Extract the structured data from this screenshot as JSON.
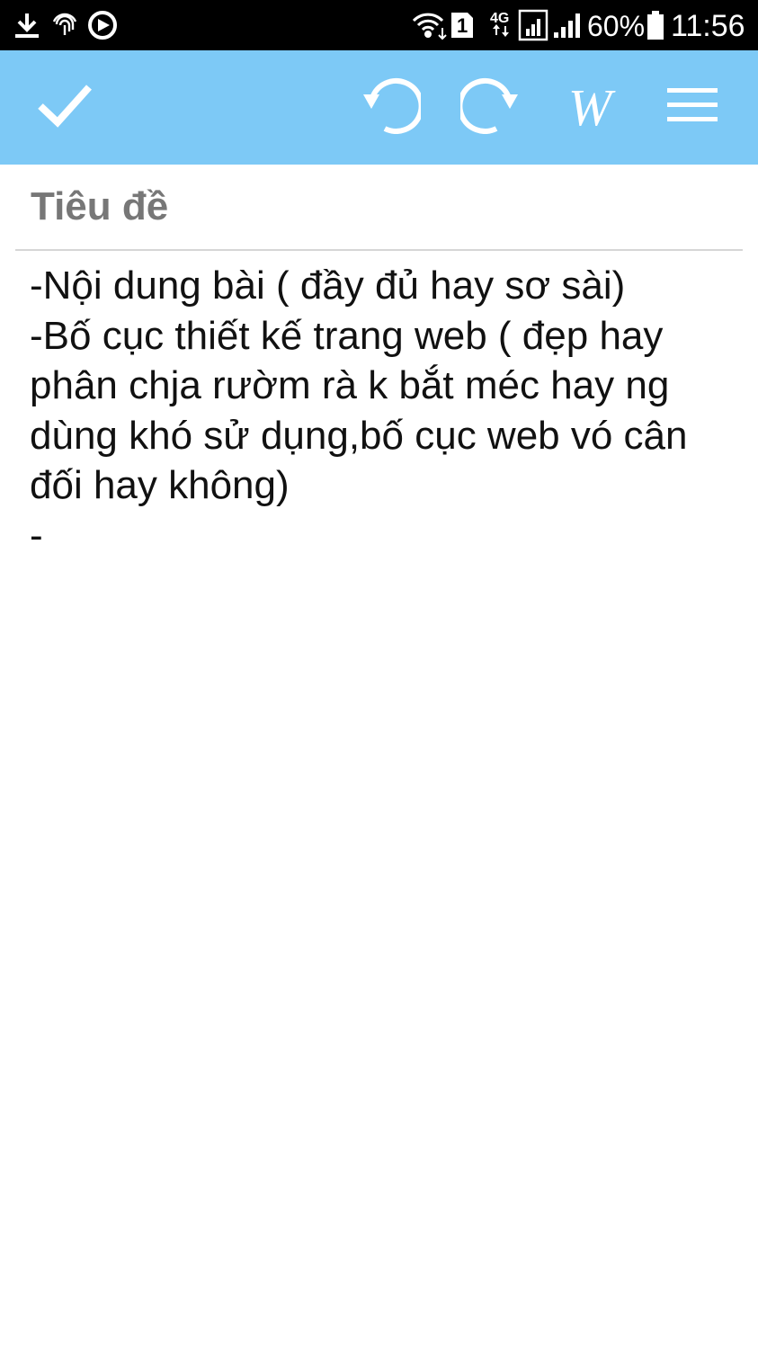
{
  "status_bar": {
    "left_icons": [
      "download-icon",
      "fingerprint-icon",
      "sync-icon"
    ],
    "sim_badge": "1",
    "network_type": "4G",
    "battery": "60%",
    "time": "11:56"
  },
  "toolbar": {
    "save_icon": "check-icon",
    "undo_icon": "undo-icon",
    "redo_icon": "redo-icon",
    "wiki_label": "W",
    "menu_icon": "menu-icon",
    "background_color": "#7dc9f6"
  },
  "editor": {
    "title_placeholder": "Tiêu đề",
    "body_lines": [
      "-Nội dung bài ( đầy đủ hay sơ sài)",
      "-Bố cục thiết kế trang web ( đẹp hay",
      "phân chja rườm rà k bắt méc hay ng",
      "dùng khó sử dụng,bố cục web vó cân",
      "đối hay không)",
      "-"
    ]
  }
}
